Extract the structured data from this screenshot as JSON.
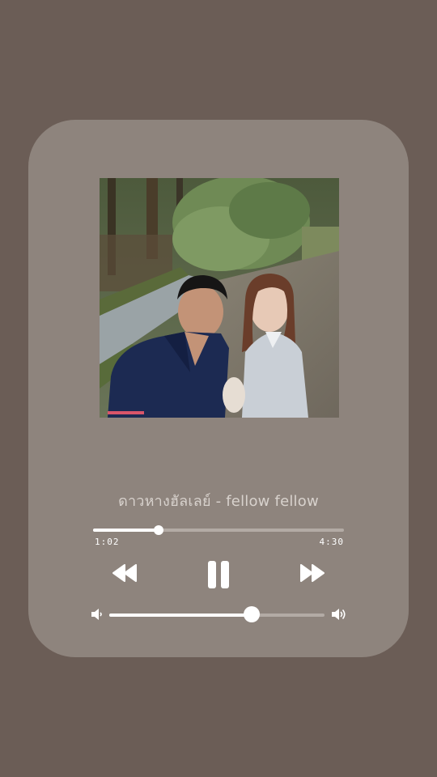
{
  "player": {
    "song_title": "ดาวหางฮัลเลย์ - fellow fellow",
    "elapsed": "1:02",
    "total": "4:30",
    "progress_fraction": 0.262,
    "volume_fraction": 0.66,
    "controls": {
      "rewind_icon": "rewind-icon",
      "pause_icon": "pause-icon",
      "forward_icon": "fast-forward-icon",
      "volume_low_icon": "volume-low-icon",
      "volume_high_icon": "volume-high-icon"
    }
  },
  "colors": {
    "background": "#6b5d56",
    "card": "#8e847d",
    "track": "#b3aba5",
    "accent": "#ffffff"
  }
}
